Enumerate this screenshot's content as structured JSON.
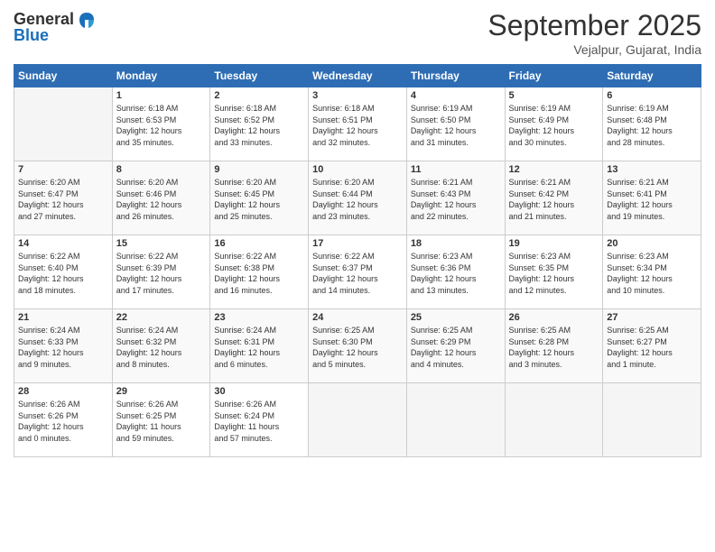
{
  "logo": {
    "general": "General",
    "blue": "Blue"
  },
  "header": {
    "month": "September 2025",
    "location": "Vejalpur, Gujarat, India"
  },
  "weekdays": [
    "Sunday",
    "Monday",
    "Tuesday",
    "Wednesday",
    "Thursday",
    "Friday",
    "Saturday"
  ],
  "weeks": [
    [
      {
        "day": "",
        "info": ""
      },
      {
        "day": "1",
        "info": "Sunrise: 6:18 AM\nSunset: 6:53 PM\nDaylight: 12 hours\nand 35 minutes."
      },
      {
        "day": "2",
        "info": "Sunrise: 6:18 AM\nSunset: 6:52 PM\nDaylight: 12 hours\nand 33 minutes."
      },
      {
        "day": "3",
        "info": "Sunrise: 6:18 AM\nSunset: 6:51 PM\nDaylight: 12 hours\nand 32 minutes."
      },
      {
        "day": "4",
        "info": "Sunrise: 6:19 AM\nSunset: 6:50 PM\nDaylight: 12 hours\nand 31 minutes."
      },
      {
        "day": "5",
        "info": "Sunrise: 6:19 AM\nSunset: 6:49 PM\nDaylight: 12 hours\nand 30 minutes."
      },
      {
        "day": "6",
        "info": "Sunrise: 6:19 AM\nSunset: 6:48 PM\nDaylight: 12 hours\nand 28 minutes."
      }
    ],
    [
      {
        "day": "7",
        "info": "Sunrise: 6:20 AM\nSunset: 6:47 PM\nDaylight: 12 hours\nand 27 minutes."
      },
      {
        "day": "8",
        "info": "Sunrise: 6:20 AM\nSunset: 6:46 PM\nDaylight: 12 hours\nand 26 minutes."
      },
      {
        "day": "9",
        "info": "Sunrise: 6:20 AM\nSunset: 6:45 PM\nDaylight: 12 hours\nand 25 minutes."
      },
      {
        "day": "10",
        "info": "Sunrise: 6:20 AM\nSunset: 6:44 PM\nDaylight: 12 hours\nand 23 minutes."
      },
      {
        "day": "11",
        "info": "Sunrise: 6:21 AM\nSunset: 6:43 PM\nDaylight: 12 hours\nand 22 minutes."
      },
      {
        "day": "12",
        "info": "Sunrise: 6:21 AM\nSunset: 6:42 PM\nDaylight: 12 hours\nand 21 minutes."
      },
      {
        "day": "13",
        "info": "Sunrise: 6:21 AM\nSunset: 6:41 PM\nDaylight: 12 hours\nand 19 minutes."
      }
    ],
    [
      {
        "day": "14",
        "info": "Sunrise: 6:22 AM\nSunset: 6:40 PM\nDaylight: 12 hours\nand 18 minutes."
      },
      {
        "day": "15",
        "info": "Sunrise: 6:22 AM\nSunset: 6:39 PM\nDaylight: 12 hours\nand 17 minutes."
      },
      {
        "day": "16",
        "info": "Sunrise: 6:22 AM\nSunset: 6:38 PM\nDaylight: 12 hours\nand 16 minutes."
      },
      {
        "day": "17",
        "info": "Sunrise: 6:22 AM\nSunset: 6:37 PM\nDaylight: 12 hours\nand 14 minutes."
      },
      {
        "day": "18",
        "info": "Sunrise: 6:23 AM\nSunset: 6:36 PM\nDaylight: 12 hours\nand 13 minutes."
      },
      {
        "day": "19",
        "info": "Sunrise: 6:23 AM\nSunset: 6:35 PM\nDaylight: 12 hours\nand 12 minutes."
      },
      {
        "day": "20",
        "info": "Sunrise: 6:23 AM\nSunset: 6:34 PM\nDaylight: 12 hours\nand 10 minutes."
      }
    ],
    [
      {
        "day": "21",
        "info": "Sunrise: 6:24 AM\nSunset: 6:33 PM\nDaylight: 12 hours\nand 9 minutes."
      },
      {
        "day": "22",
        "info": "Sunrise: 6:24 AM\nSunset: 6:32 PM\nDaylight: 12 hours\nand 8 minutes."
      },
      {
        "day": "23",
        "info": "Sunrise: 6:24 AM\nSunset: 6:31 PM\nDaylight: 12 hours\nand 6 minutes."
      },
      {
        "day": "24",
        "info": "Sunrise: 6:25 AM\nSunset: 6:30 PM\nDaylight: 12 hours\nand 5 minutes."
      },
      {
        "day": "25",
        "info": "Sunrise: 6:25 AM\nSunset: 6:29 PM\nDaylight: 12 hours\nand 4 minutes."
      },
      {
        "day": "26",
        "info": "Sunrise: 6:25 AM\nSunset: 6:28 PM\nDaylight: 12 hours\nand 3 minutes."
      },
      {
        "day": "27",
        "info": "Sunrise: 6:25 AM\nSunset: 6:27 PM\nDaylight: 12 hours\nand 1 minute."
      }
    ],
    [
      {
        "day": "28",
        "info": "Sunrise: 6:26 AM\nSunset: 6:26 PM\nDaylight: 12 hours\nand 0 minutes."
      },
      {
        "day": "29",
        "info": "Sunrise: 6:26 AM\nSunset: 6:25 PM\nDaylight: 11 hours\nand 59 minutes."
      },
      {
        "day": "30",
        "info": "Sunrise: 6:26 AM\nSunset: 6:24 PM\nDaylight: 11 hours\nand 57 minutes."
      },
      {
        "day": "",
        "info": ""
      },
      {
        "day": "",
        "info": ""
      },
      {
        "day": "",
        "info": ""
      },
      {
        "day": "",
        "info": ""
      }
    ]
  ]
}
